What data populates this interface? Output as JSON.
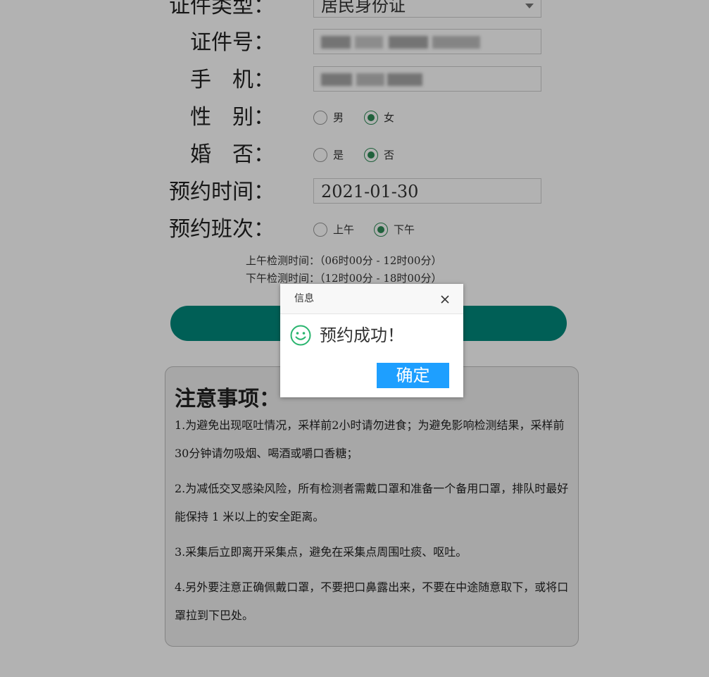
{
  "form": {
    "id_type_label": "证件类型：",
    "id_type_value": "居民身份证",
    "id_number_label": "证件号：",
    "phone_label": "手　机：",
    "gender_label": "性　别：",
    "gender_options": [
      "男",
      "女"
    ],
    "gender_selected": "女",
    "married_label": "婚　否：",
    "married_options": [
      "是",
      "否"
    ],
    "married_selected": "否",
    "date_label": "预约时间：",
    "date_value": "2021-01-30",
    "shift_label": "预约班次：",
    "shift_options": [
      "上午",
      "下午"
    ],
    "shift_selected": "下午",
    "morning_time": "上午检测时间：（06时00分 - 12时00分）",
    "afternoon_time": "下午检测时间：（12时00分 - 18时00分）"
  },
  "notice": {
    "title": "注意事项：",
    "items": [
      "1.为避免出现呕吐情况，采样前2小时请勿进食；为避免影响检测结果，采样前30分钟请勿吸烟、喝酒或嚼口香糖；",
      "2.为减低交叉感染风险，所有检测者需戴口罩和准备一个备用口罩，排队时最好能保持 1 米以上的安全距离。",
      "3.采集后立即离开采集点，避免在采集点周围吐痰、呕吐。",
      "4.另外要注意正确佩戴口罩，不要把口鼻露出来，不要在中途随意取下，或将口罩拉到下巴处。"
    ]
  },
  "dialog": {
    "title": "信息",
    "message": "预约成功！",
    "ok_label": "确定",
    "icon": "smile-icon",
    "close_icon": "close-icon"
  },
  "colors": {
    "submit": "#00897b",
    "radio_checked": "#2e8b57",
    "ok_button": "#1e9fff",
    "smile": "#2ab56f"
  }
}
